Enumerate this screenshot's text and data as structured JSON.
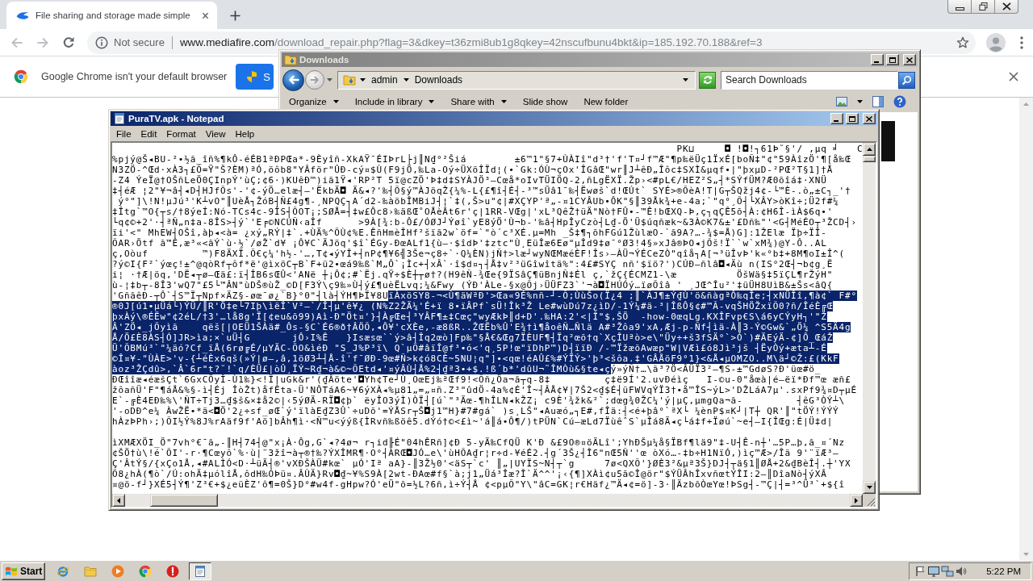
{
  "browser": {
    "tabs": [
      {
        "title": "File sharing and storage made simple",
        "selected": true
      }
    ],
    "address_bar": {
      "security_label": "Not secure",
      "host": "www.mediafire.com",
      "path": "/download_repair.php?flag=3&dkey=t36zmi8ub1g8qkey=42nscufbunu4bkt&ip=185.192.70.188&ref=3"
    },
    "infobar": {
      "message": "Google Chrome isn't your default browser",
      "button": "S"
    }
  },
  "explorer": {
    "title": "Downloads",
    "active": false,
    "breadcrumb": [
      "admin",
      "Downloads"
    ],
    "search": {
      "placeholder": "Search Downloads"
    },
    "toolbar": [
      {
        "label": "Organize",
        "dropdown": true
      },
      {
        "label": "Include in library",
        "dropdown": true
      },
      {
        "label": "Share with",
        "dropdown": true
      },
      {
        "label": "Slide show",
        "dropdown": false
      },
      {
        "label": "New folder",
        "dropdown": false
      }
    ]
  },
  "notepad": {
    "title": "PuraTV.apk - Notepad",
    "active": true,
    "menu": [
      "File",
      "Edit",
      "Format",
      "View",
      "Help"
    ],
    "lines": [
      {
        "kind": "text",
        "segments": [
          {
            "text": "                                                                                              PK⊔     ◘ !◘!┐61Þ˘§'/ ,µq ╛   C",
            "selected": false
          }
        ]
      },
      {
        "kind": "text",
        "segments": [
          {
            "text": "%pjý@Š◂BU-²•½ã_îñ%¶kÔ-éÉB1ªÐPŒa*-9Èyîñ-XkAŸ¯ÉIÞrL├j║N₫°²Šiá        ±6™1\"§7+ÙÀIî\"d³†'f'T¤┘f™Æ\"¶p‰ëÜç1ÏxÉ[boÑ‡\"¢\"59ÀîzÖ'¶[å‰Œ",
            "selected": false
          }
        ]
      },
      {
        "kind": "text",
        "segments": [
          {
            "text": "N3ZÖ-^Œd·xÀ3┐£Õ=Ÿ\"Š?ÈM)ªÓ,öôb8\"YÂför\"ÛÐ-cý¤$Ù(F9jÖ,‰La-Oý÷ÜXöÎÏd¦(•`Gk:ÓÙ¬çOx'ÎGâŒ\"wr║J┴êÐ„Îôc‡SXÌ&µqf•|\"þxµD-²PŒ²T§1]†Å",
            "selected": false
          }
        ]
      },
      {
        "kind": "text",
        "segments": [
          {
            "text": "-Z4 ÝeÏ@†OŠñLeÖ0ÇInpÝ'ùÇ;¢6·)KUêÐ™)iã1Ÿ◂'RP²T 5ï@cZÖ'Þ‡d‡SYÀJÖ³—Cœå*oIvTÜIÖQ-2,ñLgËXÏ.Žp›<#pL€/HEZ²S„┤*SÝfÜM?Æ0õîá‡·XNÜ",
            "selected": false
          }
        ]
      },
      {
        "kind": "text",
        "segments": [
          {
            "text": "‡┤éÆ ¦2\"¥¬â┤◂D┤HJfÕs'-'¢-ýÖ…elæ┤—'ËkbÄ◘ Ä&◂?'‰┤Õ§ý™ÀJöqŽ{¼%-L{£¶î┤É┤-³™sÜâ1¯‰┤Ëwøš`d!ŒÚt` SYÉ>®ÕèA!T|G┬ŠQžj4¢-└™È-.ò„±C┐_'†",
            "selected": false
          }
        ]
      },
      {
        "kind": "text",
        "segments": [
          {
            "text": " ý°\"]\\!N!µJú³'K┴vO\"║UèÅ┐ŽóB┤Ñ£4g¶-¸NPQÇ┐A´d2-‰àöbÎMBiJ┤¦`‡(,Š>u\"¢|#XÇYP'ª„-¤1CYÂUb•ÔK\"§║39Åk¾+e-4a;`\"q°¸Õ┤└XÂY>òKî÷;Ü2f#¼",
            "selected": false
          }
        ]
      },
      {
        "kind": "text",
        "segments": [
          {
            "text": "‡Îtg`™O{┬s/†8ýeÍ:Nó-TCs4c-9ÎS┤ÕOT¡;SØÅ=┤‡w£Ôc8›‰äßŒ˚OÅèÂt6r'ç|1RR-VŒg|'xL³QêŽ†üÄ\"Nò†FÛ•-™Ê!bŒXQ-Þ,ç┐qÇÊ5õ┤À:¢H6Î-ìÀ$6q•'",
            "selected": false
          }
        ]
      },
      {
        "kind": "text",
        "segments": [
          {
            "text": "└q¢©+2'·┤ªÑ„n‡a-8ÎS>┤ý`'E╒©NCÚÑ‹aÎf      >9À[¾:b-Ô£/ÓØJ┘Ýøî`yE8ýÖ'Ù¬b-'‰â┤HpÎyCzò┤L₫-Ö'Ü$úqñæk~&3À©K7&±'£Dñ‰\"'<G┤MéÉO┬³ŽCD┤›",
            "selected": false
          }
        ]
      },
      {
        "kind": "text",
        "segments": [
          {
            "text": "ïi'<\" MhEW┤OŠî,àþ◂<à= ¿xý„RÝ|‡`.+ÙÄ%^ÕÙ¢%E.ÊñHmèÎHf²šïã2w`öf=`\"ò´c³XÉ.µ=Mh _Š‡¶┐õhFGú1ŽùlæO-`ã9A?…-¾$=Å)G]:1ŽElæ Ïþ÷ÏÎ-",
            "selected": false
          }
        ]
      },
      {
        "kind": "text",
        "segments": [
          {
            "text": "ÕAR›Ötf ã™Ê,æ³«<ãÝ`ù·½`/øŽ`d¥ ¡Ô¥C`ÄJöq'$î`ÉGy-ÐœALf1{ù—·$îdÞ'‡ztc\"Ù¸EüÎæ6Eø\"µÎd9‡ø¯°Ø3!4§»xJâ®ÞO◂jÕš!Ï``w`xM¾)@Y-Ô..AL",
            "selected": false
          }
        ]
      },
      {
        "kind": "text",
        "segments": [
          {
            "text": "ç,Oòuf         ™)F8ÄXÏ.Õ€ç¼'h½-'…,T¢◂ýYÎ+┤nP¢¶¥6╣3Še¬ç8÷`·Q¼ÈN)jÑ†>læ┘wyNŒMæéÈF!Îs›—ÀÜ¬ÝÉCeZÒ\"qîå┐A[¬³üÎvÞ'k«°b‡+8M¶oI±Î^(",
            "selected": false
          }
        ]
      },
      {
        "kind": "text",
        "segments": [
          {
            "text": "?ý©I{F²`ýœç!±^@qòRf┬ôf*ë'@ìxöC┬B`F+ü2•œá9‰ß`M„Ô`¡Ìc+┤xÂ`·î$d¤┐┤Å‡v²³üGîwîtä%\":4£#SYÇ nñ'$ïö?')CÚÐ—ñlâ◘◂Äù n(IS°2Œ┤¬b¢g¸Ë",
            "selected": false
          }
        ]
      },
      {
        "kind": "text",
        "segments": [
          {
            "text": "i¦ ·†Æ|öq,'DË◂┬ø—Œä£:ï┤ÎB6sŒÛ<'ANë ┼¡Ô¢;#`Ëj.qŸ÷$È┼┬ø†?(H9êÑ-¾Œe{9ÏSâÇ¶üBnjÑ‡Él ç,`žÇ{ÉCMZ1-\\æ          ÖšWä§‡5ïÇL¶rŽýH\"",
            "selected": false
          }
        ]
      },
      {
        "kind": "text",
        "segments": [
          {
            "text": "ù-¦‡b┬-8Î3'wQ7\"£5└™ÂN\"ùDŠ®ùŽ_©D[F3Ý\\ç9‰»Ù┤ý£¶uèËLvq;¼&Fwy (ÝÐ'ÀLe-§x@Õj›ÜÜFZ3`'¬à◘ÏHÚÓý…ïøÕîâ ' ¸JŒ^Îu²'‡üÜH8UìB&±Šs<âQ{",
            "selected": false
          }
        ]
      },
      {
        "kind": "text",
        "segments": [
          {
            "text": "'GñãêÐ-┬Ô`┤S™Ï┬Npf×ÄZ§-øœ¯ø¿`B}°0\"┤là┤ÝH¶ÞÏ¥8U",
            "selected": false
          },
          {
            "text": "ïÀxöSY8-¬<Ù¶äWªÐ'>Œa«9É%nñ-┘-Õ;ÙùŠo(Ï¿4 ;║`ÃJ¶±Ý₫Ù'ö&ñàgªÔ‰qÎe;┤xNÜÎî,¶à¢` F#°",
            "selected": true
          }
        ]
      },
      {
        "kind": "text",
        "segments": [
          {
            "text": "®0J[ú1•µÜá└)ÝÜ/║R'Ö‡e└7Iþ\\ìëÎ`V²—`/Î┤µ'ê¥¿ (N%Z2ŽÄ¼'É+ï 8•ïÂPf`sÜ!Îk³Ž Le#wùDú7z¿ìD/-1Ý¼#ä-³|ÎßÔ§¢#™Ã-vqŠHÖŽxïÕ0?ñ/ÎéÈ╔Œ",
            "selected": true
          }
        ]
      },
      {
        "kind": "text",
        "segments": [
          {
            "text": "þxÀý\\®ÉËw\"¢2éL/†3'…lå8g'Ï[¢eu&õ99)Aì-Ð\"Öt¤'}┤À╔Œe┤³YÂF¶±‡Cœç\"wyÆkÞ║d+D'.‰HA:2'<|Î\"$,ŠÖ  -how-0œqLg.KXÎFvp€S\\á6yCÝyH┐'\"Ž",
            "selected": true
          }
        ]
      },
      {
        "kind": "text",
        "segments": [
          {
            "text": "Â'ZÖ◂_jÕyìã    qëš[|OEÜ1ŠÀä#_Ôs-§C`É6®ð†ÂÖÕ,◂Ô¥'cXÈe,-æ8ßR..ŽŒËb%Û'E¾†ì¶åoêÑ…Ñlä A#³Žôa9'xA,Æj-p-Ñf┤ìä-À║3-Ý©Gw&`„Ö¼ ^S5Ä4g",
            "selected": true
          }
        ]
      },
      {
        "kind": "text",
        "segments": [
          {
            "text": "Å/Ö£È8ÀS┤Ó]JR>ìa;×`uÜ┤G       jÔ›I%Ê   }Isæsœ``ý>â┤Îq2œò]Fp‰\"§Å€&Œg7ÏÈUF¶┤Ïq²œõ†q`XçÎUªò>e\\\"Üy÷+š3fSÄ°`>Ó`)#ÄEýÄ-¢]Ô_ŒáŽ",
            "selected": true
          }
        ]
      },
      {
        "kind": "text",
        "segments": [
          {
            "text": "Ü'ÕBMú³`\"¼äó?Cf_ïÅ(6rø╔É/µYÄC-ÕO&ìéÐ \"S_J%P³ï\\ Q`µÕ#âïÎ@f³•ó<'q¸5P!œ\"ïDhP™)D┤ïïÐ /-™ÏžæõAwæp\"W|VÆì£ó8Jì³jš ┤ËyÒý+æta┴-É",
            "selected": true
          }
        ]
      },
      {
        "kind": "text",
        "segments": [
          {
            "text": "©Î¤¥-\"ÙÀE>'v-{┴éÈx6qš(»Ý|ø—,â,1öØ3┴┤Å-î'f¯ØÐ-9œ#Ñ>k¢ó8CÈ~5NU¦q\"]•<qœ!éAÛ£%#ÝÏÝ>'þ³<šôa.‡'GÂÅöF9°1}<&Å◂µOMZO..M\\ä┘©Ž:£(KkF",
            "selected": true
          }
        ]
      },
      {
        "kind": "text",
        "segments": [
          {
            "text": "àoz³ŽÇdû>,`Â`6r\"t?˘!`q/ÈÜ£|òÛ¸ÏÝ~R₫¬à&©~ÕEtd◂'¤ýÂÙ┤Å%2┤₫ª3•+$.!ß´b*'dûU¬˜ÎMÒù&§te◂ç",
            "selected": true
          },
          {
            "text": "ý»ýÑ†…\\ã³?Ö<ÂÜÏ3²—¶S-±™GdøS?Ð'üœ#ö_",
            "selected": false
          }
        ]
      },
      {
        "kind": "text",
        "segments": [
          {
            "text": "ÐŒîîæ◂éæšÇt`6GxCÖyÎ-Ù1‰}<!Ï|uGk&r'(₫Âöte'◘Yh¢Te┘Ù¸OœEj‰ªŒf9!<Õñ¿Öa¬ã┬q-8‡         ç‡ë9Í'2.uvÐéìç   I-©u-0\"åœà|é—ëï*Ðf™œ æñ£",
            "selected": false
          }
        ]
      },
      {
        "kind": "text",
        "segments": [
          {
            "text": "žôañÜ'F\"¶áÅ&%§-ì┤Éj ÎòŽt)åfÊta-Ü'NÔTáA6~¥6ýXÀ◂%µ81„=„¤ñ.Z³\"ûdÖ-4a%¢É'Î~┤ÂÅ¢¥|7Š2<₫$É┤üFWVqÝÏ3†•å™ÎS~ýL>'DŽLáA7µ'.sxPf9¾¤D┬µÉ",
            "selected": false
          }
        ]
      },
      {
        "kind": "text",
        "segments": [
          {
            "text": "E`-╔È4EÐ‰%\\'ÑT÷Tj3…₫$š&×‡å2©|‹5ýØÄ-RÏ◘¢þ` ëyÎO3ýÌ)ÒÏ┤[ú`\"³Äœ-¶hÎLN◂kŽZ¡ c9È'¾žk&²`;dœg¾0ŽC¼'ý|µÇ,µmgQa¬ã-         ┤êG³ÒÝ┴\\",
            "selected": false
          }
        ]
      },
      {
        "kind": "text",
        "segments": [
          {
            "text": "'-oDÐ^e¼ ÀwŽË•*ä<◘Ö'2¿÷sf_øŒ`ý'ïlàE₫Z3Û`÷uDõ'=ÝÅSr┬Š◘j1™H}#7#gá` )s¸LŠ\"◂Auæó„┐E#,fÎä:┤<é+þâ°`ªX└ ¼ènP$¤K┘|T┼ QR'║\"tÖÝ!ÝÝÝ",
            "selected": false
          }
        ]
      },
      {
        "kind": "text",
        "segments": [
          {
            "text": "hÀzÞPh›;)ÕI½Ý%8J%rAäf9f'Aö]bÂh¶ì·<Ñ™u<ýýß{ÌRvñ‰ßöê5.dÝó†©<£ì~'á║á•Ô¶/)tPÜN`Cú—æLd7ÏùêˆS`µÎá8Ä◂ç└á‡f+Ïøú`~e┤—I{ÎŒg:É|Ü‡d|",
            "selected": false
          }
        ]
      },
      {
        "kind": "blank"
      },
      {
        "kind": "text",
        "segments": [
          {
            "text": "ìXMÆXÖI_Ö\"7vh°€¯ã„-║H┤74┤@\"x¡À·Ôg,G`◂?4ø¬ r┐id╟É\"04hÊRñ]¢Ð 5-yÄ‰CfQÜ K'Ð &£9O®¤öÄLî';YhÐŠµ¼å§ÏBf¶lä9\"‡-U┤Ê-n┼'…5P…þ,ã_¤´Nz",
            "selected": false
          }
        ]
      },
      {
        "kind": "text",
        "segments": [
          {
            "text": "¢ŠÖ†ù\\!é`ÕI'-r·¶Cœyô`%·ù|¨3žî¬à┬®†‰?ÝXÎMR¶·O°┤ÀRŒ◘JÓ…e\\'ùHÕA₫r¦r÷d-¥éÉ2.┤g´3Š¿┤Î6\"nŒ5Ñ''œ òXó…-‡b÷H1NïÓ,)ìç™Æ>/Îä 9'¨ïÆ³—",
            "selected": false
          }
        ]
      },
      {
        "kind": "text",
        "segments": [
          {
            "text": "Ç'ÂtÝ§/{xÇo1Å,◂#ALÌÓ<D·┴üÄ┤®'vXÐŠÀÜ#kœ` µÓ'Iª aA}-║3Ž½0'<äS┬`c' ║„|UYÏS~N┤┬`g     7ø<QXÕ'}ØÈ3²&µª3Š}DJ┤┬ä§1║ØÅ+2&₫BèÎ┤.┼'YX",
            "selected": false
          }
        ]
      },
      {
        "kind": "text",
        "segments": [
          {
            "text": "Õ8¿hÀ(¶ò`/Ú:ohÄ‡µólîÅ,ôdH‰ÓÞü¤.ÂÙÄ}Rv◘₫~¥%S9À[2wt-ÐAœ#f§`à;j1„Üá³Îæ?Î`Ä^^'¡‹{¶]XÀì¢u5ã©Î@ör\"$ÝÜÂhÎxvñœtÝÎI:2—║DîaNò┤ýXÂ",
            "selected": false
          }
        ]
      },
      {
        "kind": "text",
        "segments": [
          {
            "text": "¤@ö-f┘}XÉ5┤Ý¶'Z³€+$¿eüÈZ'ô¶=0Š}D°#w4f-gHpw?Ó'eÜ\"õ=½L?6ñ,ì÷Ý┤Å ¢<pµÕ\"Y\\\"âC=GK¦r€Häf¿™Ä◂¢=ö]-3·║ÄzbõÒœYœ!ÞSg┤-™Ç|┤=³^Ü³`+${î",
            "selected": false
          }
        ]
      }
    ]
  },
  "taskbar": {
    "start": "Start",
    "tasks": [
      {
        "selected": true
      }
    ],
    "clock": "5:22 PM"
  }
}
